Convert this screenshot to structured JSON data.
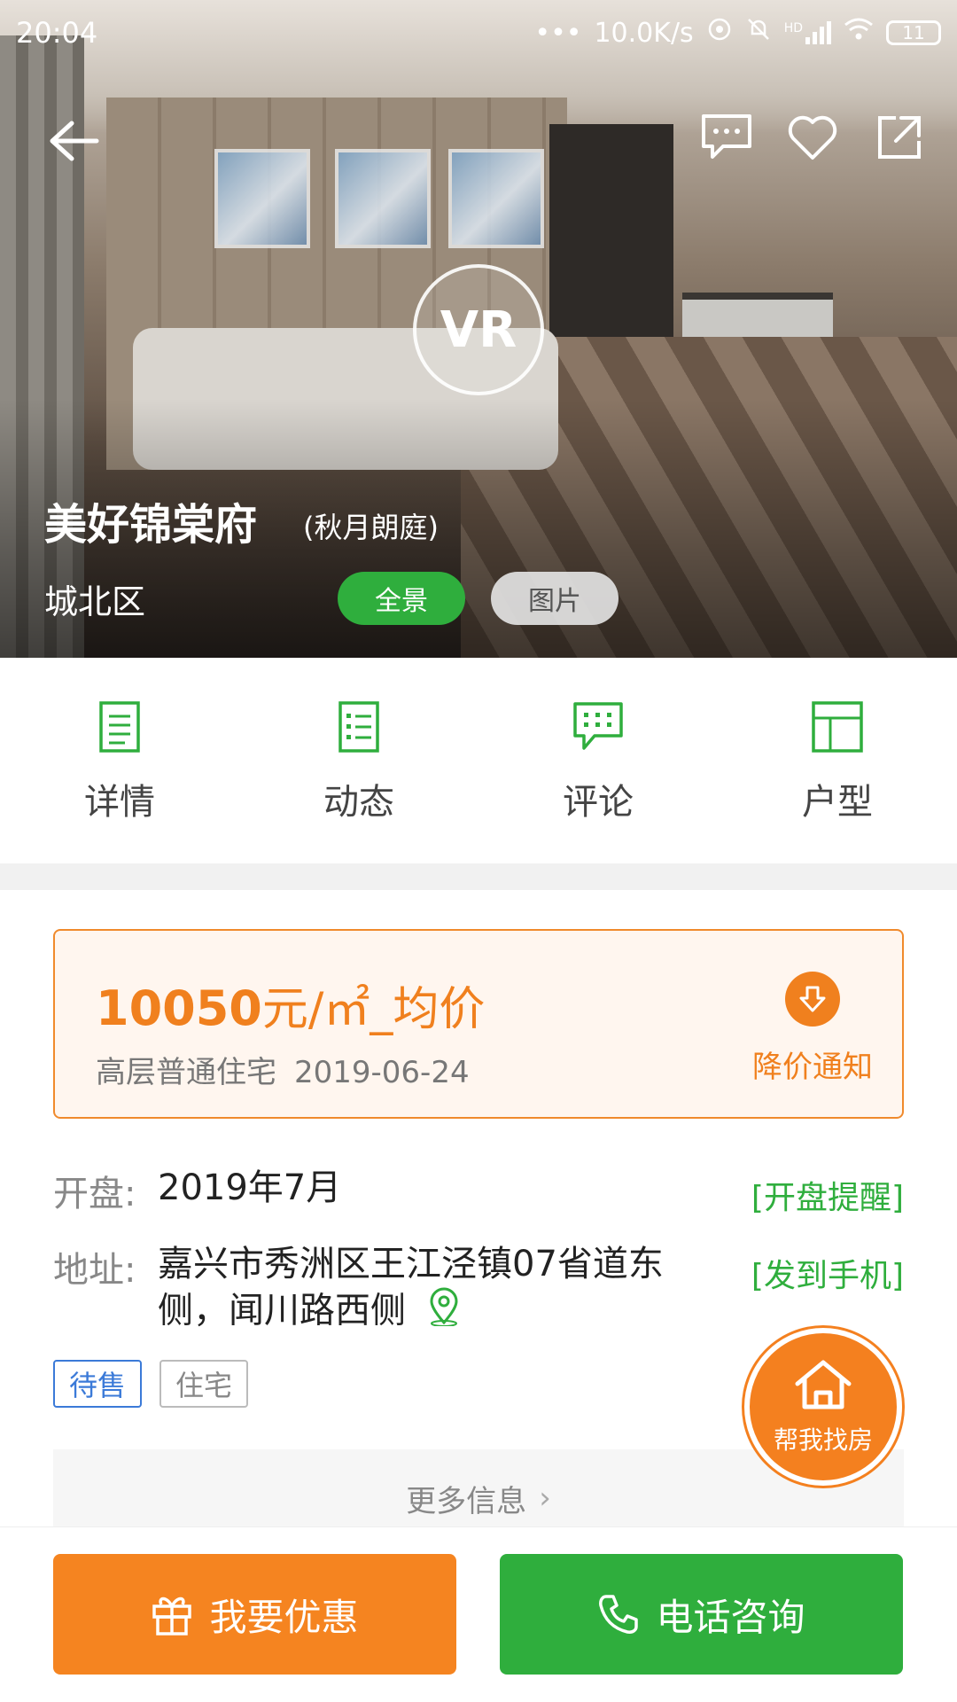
{
  "status_bar": {
    "time": "20:04",
    "network_speed": "10.0K/s",
    "signal_label": "HD",
    "battery": "11"
  },
  "hero": {
    "title": "美好锦棠府",
    "alias": "(秋月朗庭)",
    "district": "城北区",
    "vr_label": "VR",
    "tabs": [
      {
        "label": "全景",
        "active": true
      },
      {
        "label": "图片",
        "active": false
      }
    ]
  },
  "quick_nav": [
    {
      "label": "详情",
      "icon": "document-icon"
    },
    {
      "label": "动态",
      "icon": "list-icon"
    },
    {
      "label": "评论",
      "icon": "chat-icon"
    },
    {
      "label": "户型",
      "icon": "floorplan-icon"
    }
  ],
  "price_card": {
    "price_number": "10050",
    "price_suffix": "元/㎡_均价",
    "property_type": "高层普通住宅",
    "date": "2019-06-24",
    "notify_label": "降价通知"
  },
  "info": {
    "opening_key": "开盘:",
    "opening_value": "2019年7月",
    "opening_link": "[开盘提醒]",
    "address_key": "地址:",
    "address_value": "嘉兴市秀洲区王江泾镇07省道东侧，闻川路西侧",
    "address_link": "[发到手机]",
    "tags": [
      "待售",
      "住宅"
    ],
    "more_label": "更多信息"
  },
  "float_button": {
    "label": "帮我找房"
  },
  "bottom_bar": {
    "discount_label": "我要优惠",
    "call_label": "电话咨询"
  },
  "colors": {
    "brand_green": "#2fae3d",
    "accent_orange": "#f0801e",
    "tag_blue": "#3b7ad8"
  }
}
